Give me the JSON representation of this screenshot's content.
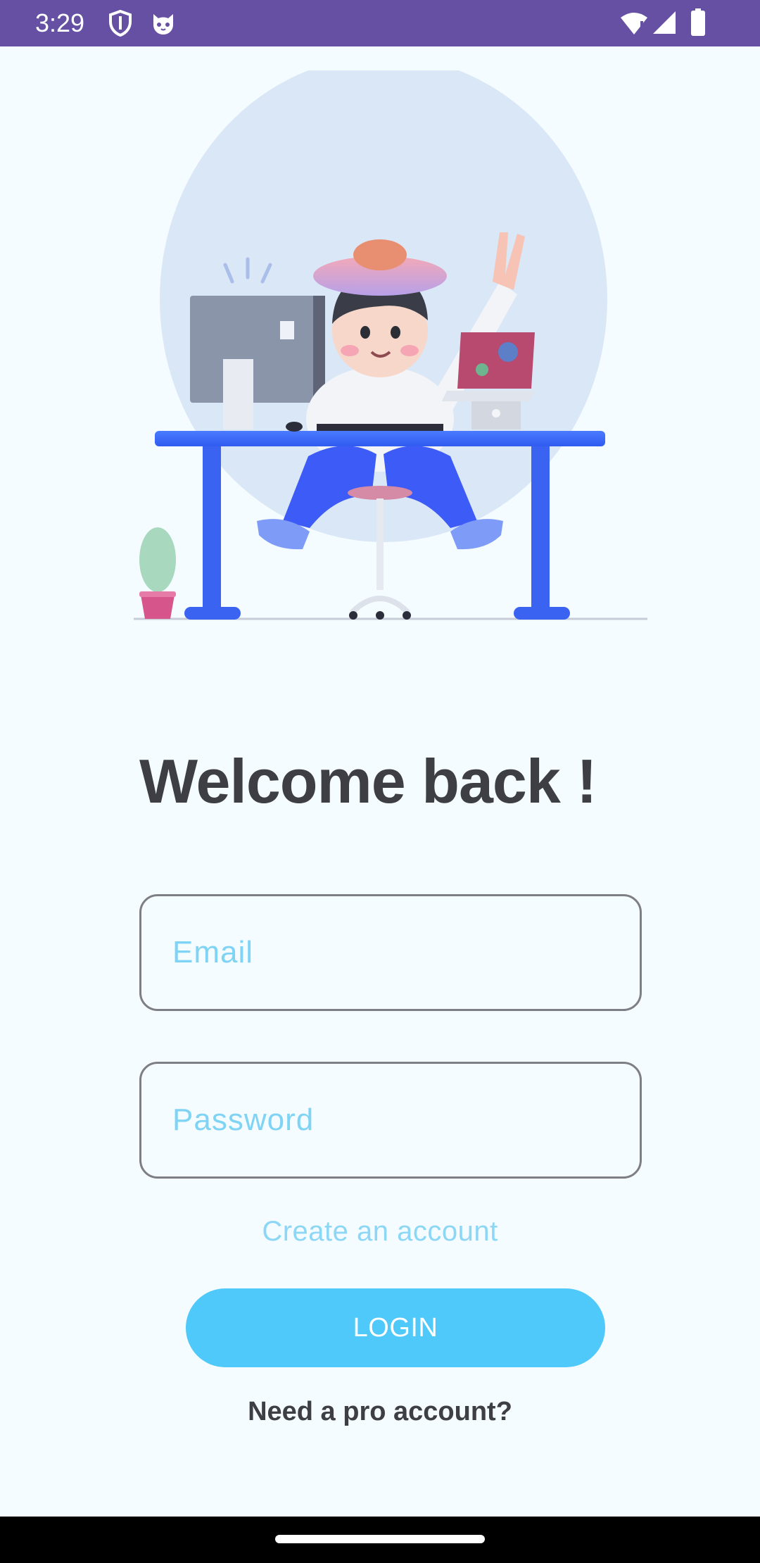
{
  "status_bar": {
    "time": "3:29",
    "icons": [
      "shield-icon",
      "cat-face-icon",
      "wifi-icon",
      "signal-icon",
      "battery-icon"
    ]
  },
  "colors": {
    "status_bar": "#6650A4",
    "background": "#F5FCFF",
    "title": "#3E3E45",
    "placeholder": "#7FD3F5",
    "link": "#8CD6F6",
    "button": "#4FC8FA",
    "field_border": "#7E7E86"
  },
  "main": {
    "title": "Welcome back !",
    "email": {
      "value": "",
      "placeholder": "Email"
    },
    "password": {
      "value": "",
      "placeholder": "Password"
    },
    "create_account_label": "Create an account",
    "login_label": "LOGIN",
    "pro_account_label": "Need a pro account?"
  }
}
